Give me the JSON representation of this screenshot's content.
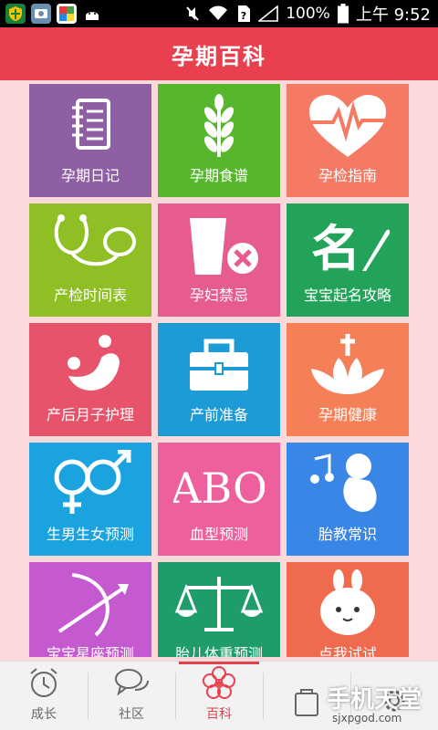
{
  "status_bar": {
    "battery": "100%",
    "time": "上午 9:52"
  },
  "header": {
    "title": "孕期百科"
  },
  "tiles": [
    {
      "label": "孕期日记",
      "color": "#8e5fa3",
      "icon": "notebook-icon"
    },
    {
      "label": "孕期食谱",
      "color": "#56b72c",
      "icon": "wheat-icon"
    },
    {
      "label": "孕检指南",
      "color": "#f47a63",
      "icon": "heartbeat-icon"
    },
    {
      "label": "产检时间表",
      "color": "#8fbf24",
      "icon": "stethoscope-icon"
    },
    {
      "label": "孕妇禁忌",
      "color": "#e65c8f",
      "icon": "cup-forbidden-icon"
    },
    {
      "label": "宝宝起名攻略",
      "color": "#23a35a",
      "icon": "calligraphy-icon"
    },
    {
      "label": "产后月子护理",
      "color": "#e8536c",
      "icon": "care-icon"
    },
    {
      "label": "产前准备",
      "color": "#1d9bd6",
      "icon": "toolbox-icon"
    },
    {
      "label": "孕期健康",
      "color": "#f57f57",
      "icon": "lotus-cross-icon"
    },
    {
      "label": "生男生女预测",
      "color": "#1aa3de",
      "icon": "gender-icon"
    },
    {
      "label": "血型预测",
      "color": "#ee5f9d",
      "icon": "abo-icon",
      "icon_text": "ABO"
    },
    {
      "label": "胎教常识",
      "color": "#3a86e6",
      "icon": "fetus-music-icon"
    },
    {
      "label": "宝宝星座预测",
      "color": "#c55ad0",
      "icon": "sagittarius-icon"
    },
    {
      "label": "胎儿体重预测",
      "color": "#1e9d6b",
      "icon": "scale-icon"
    },
    {
      "label": "点我试试",
      "color": "#f06a4d",
      "icon": "bunny-icon"
    }
  ],
  "tabbar": {
    "items": [
      {
        "label": "成长",
        "icon": "alarm-clock-icon"
      },
      {
        "label": "社区",
        "icon": "chat-bubbles-icon"
      },
      {
        "label": "百科",
        "icon": "flower-icon",
        "active": true
      },
      {
        "label": "",
        "icon": "bag-icon"
      },
      {
        "label": "",
        "icon": "settings-icon"
      }
    ]
  },
  "watermark": {
    "main": "手机天堂",
    "sub": "sjxpgod.com"
  }
}
